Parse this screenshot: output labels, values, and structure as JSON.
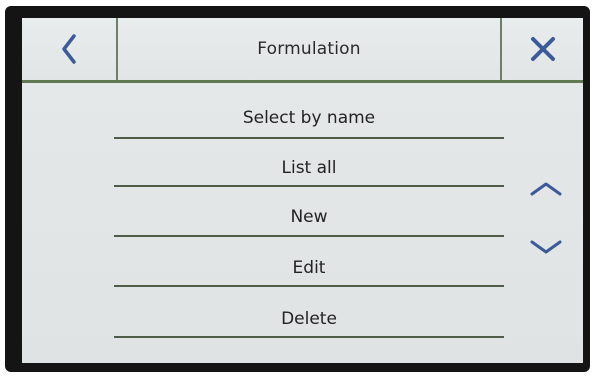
{
  "header": {
    "title": "Formulation",
    "back_icon": "chevron-left-icon",
    "close_icon": "close-icon"
  },
  "menu": {
    "items": [
      {
        "label": "Select by name"
      },
      {
        "label": "List all"
      },
      {
        "label": "New"
      },
      {
        "label": "Edit"
      },
      {
        "label": "Delete"
      }
    ]
  },
  "scroll": {
    "up_icon": "chevron-up-icon",
    "down_icon": "chevron-down-icon"
  },
  "colors": {
    "accent_blue": "#3a5a9a",
    "divider_green": "#5f7a53",
    "screen_bg": "#e3e6e7"
  }
}
